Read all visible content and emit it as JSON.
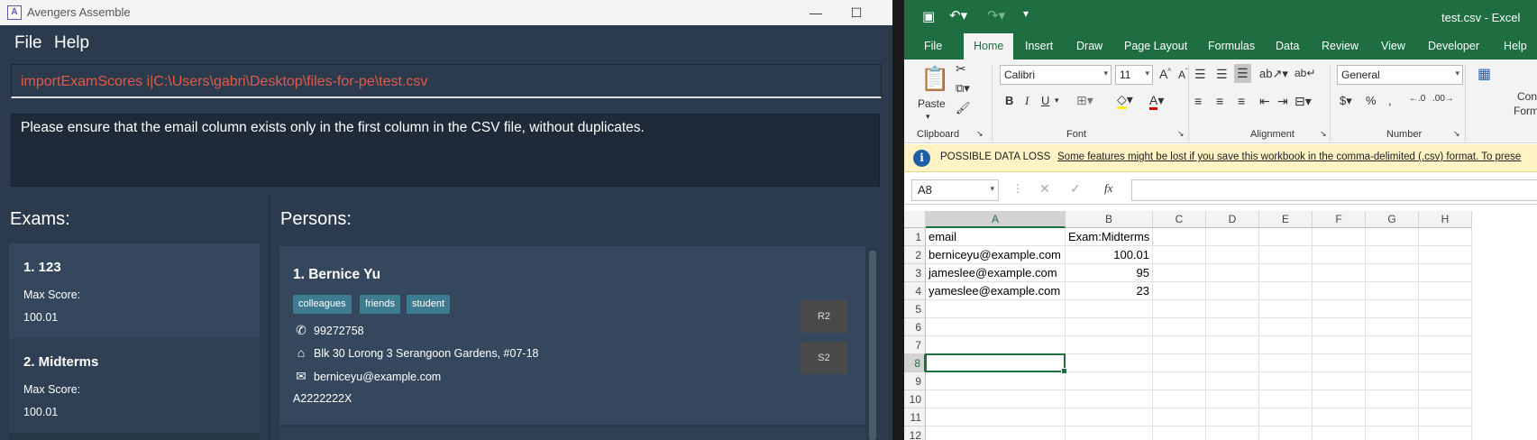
{
  "app": {
    "title": "Avengers Assemble",
    "logo": "A",
    "menu": [
      "File",
      "Help"
    ],
    "command": "importExamScores i|C:\\Users\\gabri\\Desktop\\files-for-pe\\test.csv",
    "result": "Please ensure that the email column exists only in the first column in the CSV file, without duplicates.",
    "exams_title": "Exams:",
    "persons_title": "Persons:",
    "exams": [
      {
        "name": "1.  123",
        "label": "Max Score:",
        "value": "100.01"
      },
      {
        "name": "2.  Midterms",
        "label": "Max Score:",
        "value": "100.01"
      }
    ],
    "person": {
      "name": "1.  Bernice Yu",
      "tags": [
        "colleagues",
        "friends",
        "student"
      ],
      "phone": "99272758",
      "address": "Blk 30 Lorong 3 Serangoon Gardens, #07-18",
      "email": "berniceyu@example.com",
      "matric": "A2222222X",
      "buttons": [
        "R2",
        "S2"
      ]
    }
  },
  "excel": {
    "filename": "test.csv  -  Excel",
    "tabs": [
      "File",
      "Home",
      "Insert",
      "Draw",
      "Page Layout",
      "Formulas",
      "Data",
      "Review",
      "View",
      "Developer",
      "Help"
    ],
    "active_tab": "Home",
    "ribbon": {
      "paste": "Paste",
      "font_name": "Calibri",
      "font_size": "11",
      "number_format": "General",
      "cond_fmt_1": "Con",
      "cond_fmt_2": "Form",
      "groups": {
        "clipboard": "Clipboard",
        "font": "Font",
        "alignment": "Alignment",
        "number": "Number"
      }
    },
    "message": {
      "title": "POSSIBLE DATA LOSS",
      "text": "Some features might be lost if you save this workbook in the comma-delimited (.csv) format. To prese"
    },
    "name_box": "A8",
    "columns": [
      "A",
      "B",
      "C",
      "D",
      "E",
      "F",
      "G",
      "H"
    ],
    "rows": [
      [
        "email",
        "Exam:Midterms"
      ],
      [
        "berniceyu@example.com",
        "100.01"
      ],
      [
        "jameslee@example.com",
        "95"
      ],
      [
        "yameslee@example.com",
        "23"
      ],
      [
        "",
        ""
      ],
      [
        "",
        ""
      ],
      [
        "",
        ""
      ],
      [
        "",
        ""
      ],
      [
        "",
        ""
      ],
      [
        "",
        ""
      ],
      [
        "",
        ""
      ],
      [
        "",
        ""
      ]
    ],
    "row_numbers": [
      "1",
      "2",
      "3",
      "4",
      "5",
      "6",
      "7",
      "8",
      "9",
      "10",
      "11",
      "12"
    ],
    "active_cell": "A8"
  },
  "colors": {
    "app_bg": "#2b3a4c",
    "command_text": "#e05a4a",
    "excel_green": "#1e6e42",
    "tag": "#3e7b91"
  }
}
